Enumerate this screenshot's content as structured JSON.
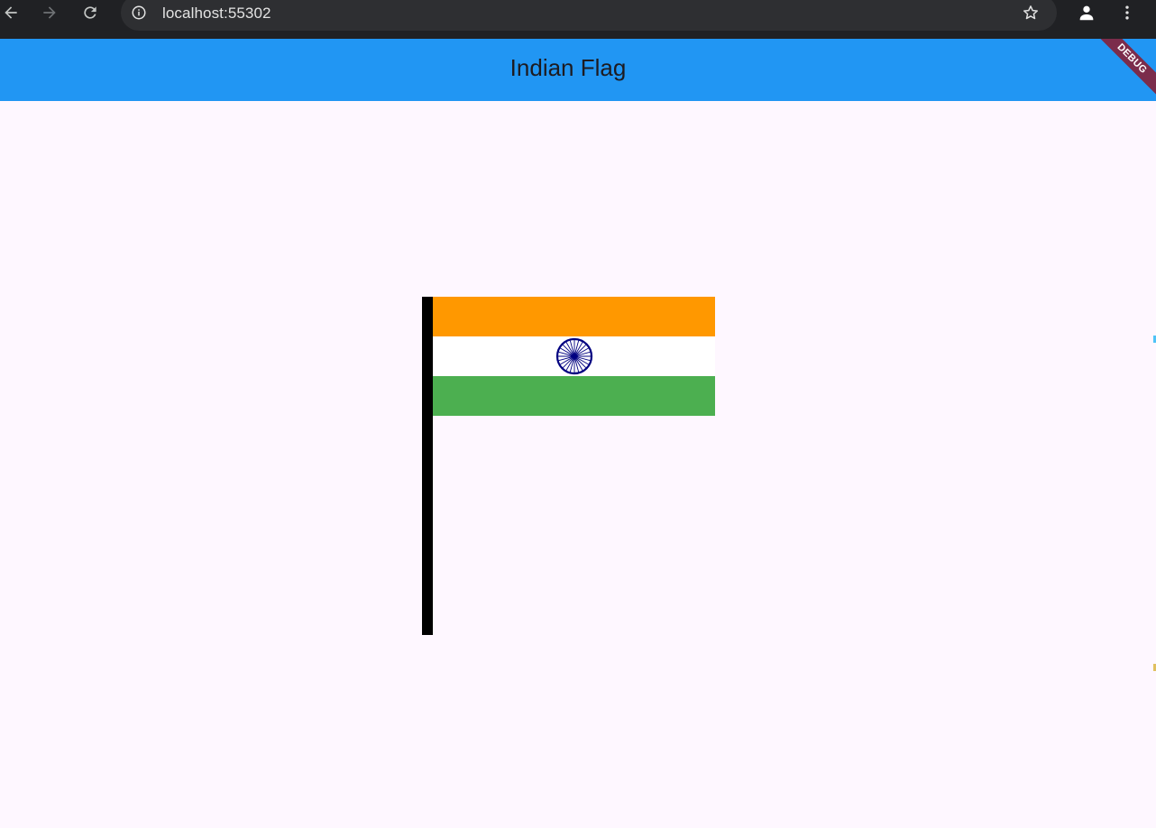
{
  "browser": {
    "url": "localhost:55302",
    "icons": {
      "back": "arrow-left-icon",
      "forward": "arrow-right-icon",
      "reload": "reload-icon",
      "site_info": "info-icon",
      "bookmark": "star-icon",
      "profile": "person-icon",
      "menu": "more-vert-icon"
    }
  },
  "app_bar": {
    "title": "Indian Flag",
    "debug_banner": "DEBUG",
    "color": "#2196f3"
  },
  "flag": {
    "colors": {
      "saffron": "#ff9800",
      "white": "#ffffff",
      "green": "#4caf50",
      "chakra": "#000080",
      "pole": "#000000"
    },
    "chakra_spokes": 24
  }
}
